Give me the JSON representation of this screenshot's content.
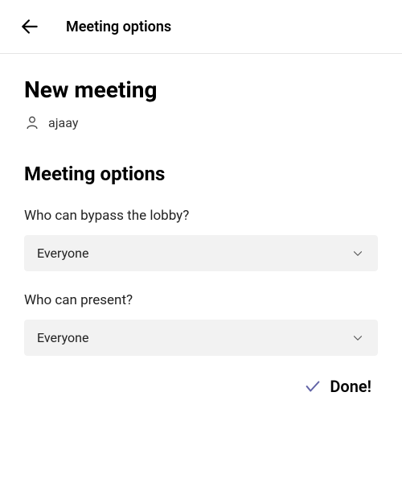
{
  "topbar": {
    "title": "Meeting options"
  },
  "page": {
    "title": "New meeting",
    "organizer": "ajaay"
  },
  "section": {
    "title": "Meeting options"
  },
  "fields": {
    "bypass_lobby": {
      "label": "Who can bypass the lobby?",
      "value": "Everyone"
    },
    "present": {
      "label": "Who can present?",
      "value": "Everyone"
    }
  },
  "done": {
    "label": "Done!"
  },
  "colors": {
    "accent": "#6264A7"
  }
}
